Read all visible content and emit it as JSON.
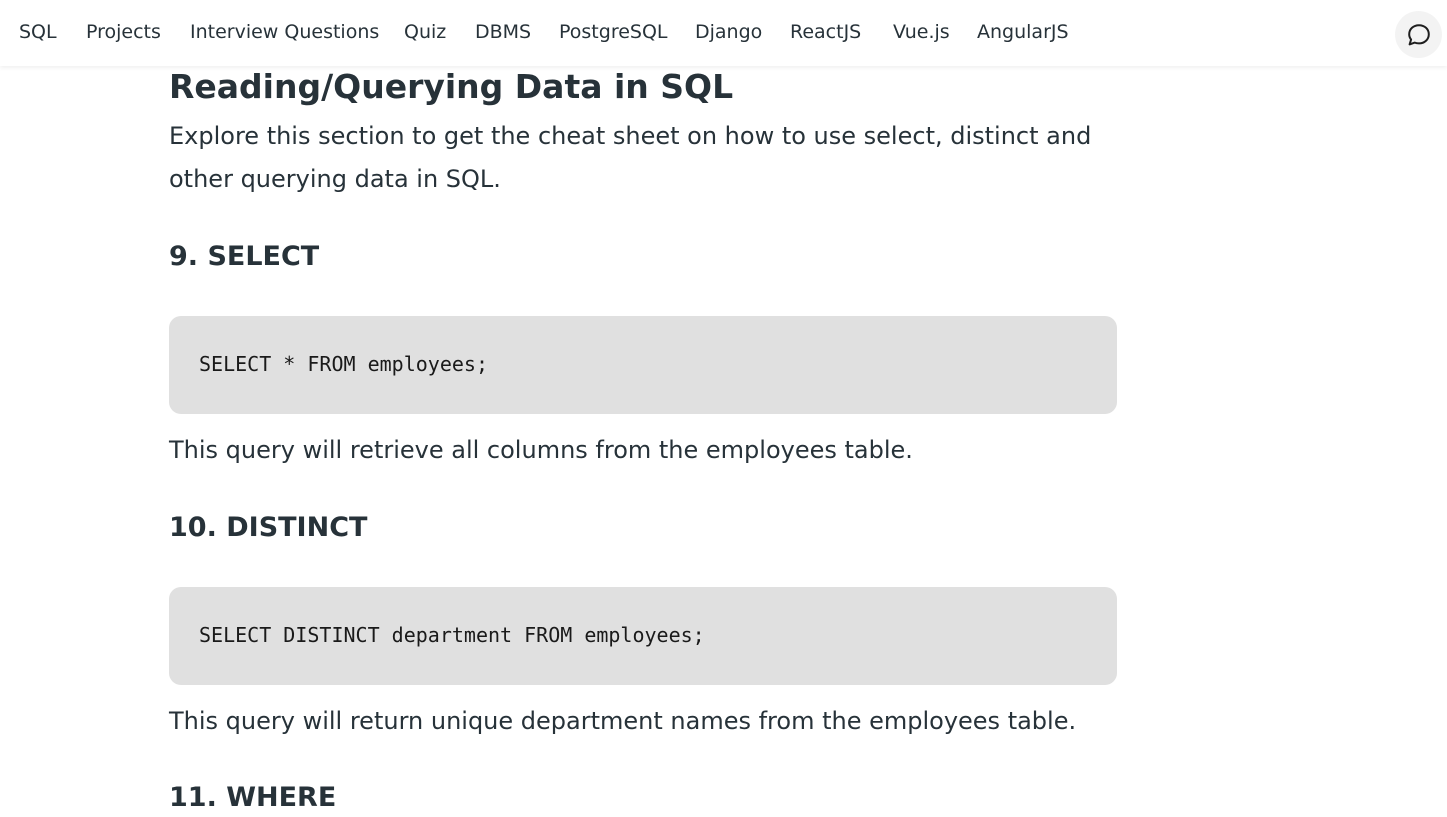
{
  "nav": {
    "items": [
      {
        "label": "SQL"
      },
      {
        "label": "Projects"
      },
      {
        "label": "Interview Questions"
      },
      {
        "label": "Quiz"
      },
      {
        "label": "DBMS"
      },
      {
        "label": "PostgreSQL"
      },
      {
        "label": "Django"
      },
      {
        "label": "ReactJS"
      },
      {
        "label": "Vue.js"
      },
      {
        "label": "AngularJS"
      }
    ],
    "chat_icon": "chat-bubble-icon"
  },
  "article": {
    "section_title": "Reading/Querying Data in SQL",
    "intro": "Explore this section to get the cheat sheet on how to use select, distinct and other querying data in SQL.",
    "items": [
      {
        "heading": "9. SELECT",
        "code": "SELECT * FROM employees;",
        "description": "This query will retrieve all columns from the employees table."
      },
      {
        "heading": "10. DISTINCT",
        "code": "SELECT DISTINCT department FROM employees;",
        "description": "This query will return unique department names from the employees table."
      },
      {
        "heading": "11. WHERE"
      }
    ]
  },
  "colors": {
    "text": "#273239",
    "code_background": "#e0e0e0",
    "page_background": "#ffffff"
  }
}
